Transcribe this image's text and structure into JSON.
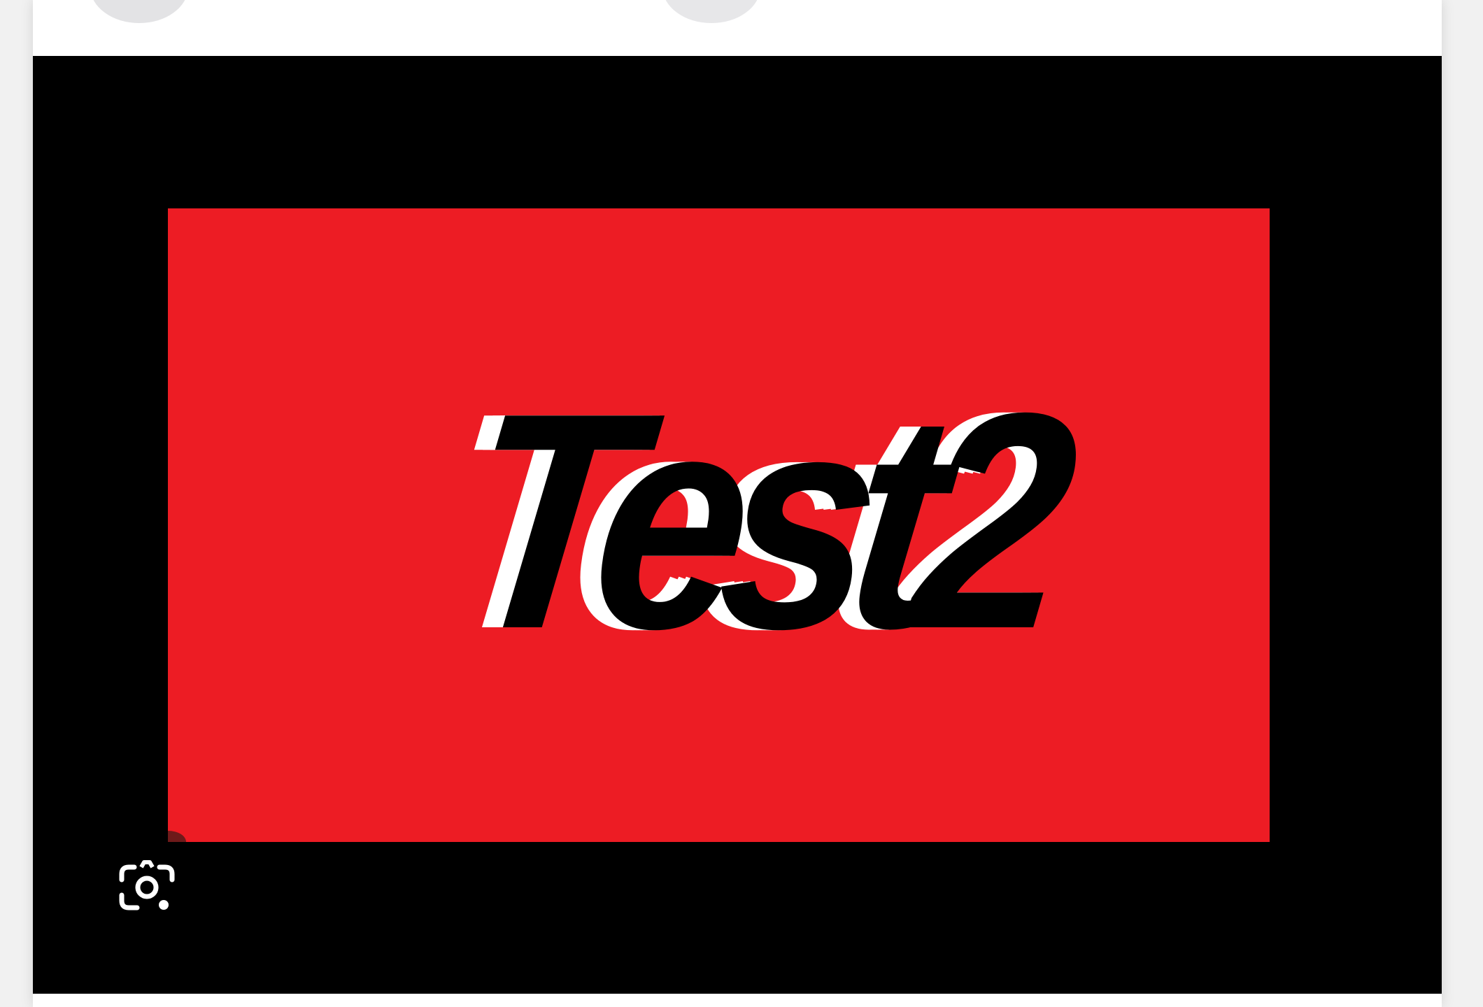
{
  "topbar": {
    "left_button_icon": "minimize-bar-icon",
    "right_button_icon": "circle-button-icon"
  },
  "image": {
    "logo_text": "Test2",
    "colors": {
      "panel_background": "#000000",
      "logo_background": "#ed1c24",
      "logo_text": "#000000",
      "logo_shadow": "#ffffff"
    }
  },
  "actions": {
    "lens_icon": "search-image-with-lens-icon"
  }
}
